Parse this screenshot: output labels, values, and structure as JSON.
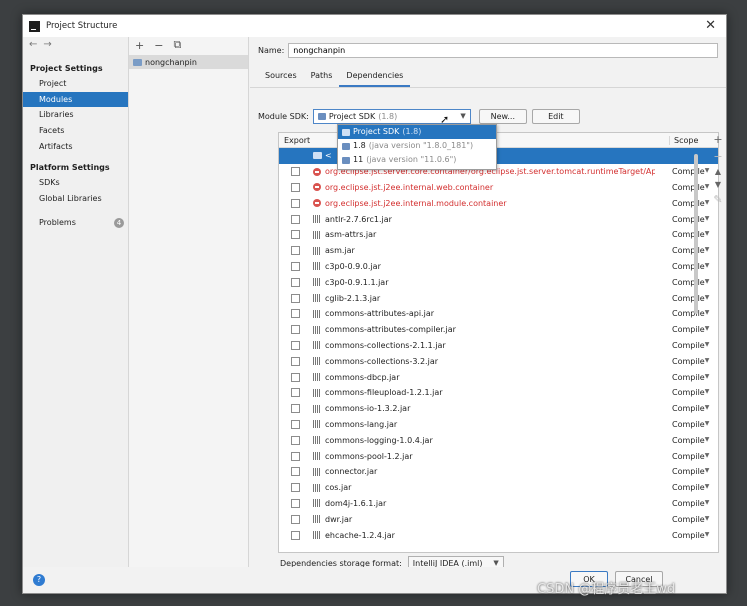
{
  "window": {
    "title": "Project Structure"
  },
  "nav": {
    "sections": [
      {
        "header": "Project Settings",
        "items": [
          "Project",
          "Modules",
          "Libraries",
          "Facets",
          "Artifacts"
        ]
      },
      {
        "header": "Platform Settings",
        "items": [
          "SDKs",
          "Global Libraries"
        ]
      }
    ],
    "selected": "Modules",
    "problems_label": "Problems",
    "problems_count": "4"
  },
  "modules": {
    "toolbar": [
      "+",
      "−",
      "⧉"
    ],
    "items": [
      "nongchanpin"
    ]
  },
  "module": {
    "name_label": "Name:",
    "name_value": "nongchanpin",
    "tabs": [
      "Sources",
      "Paths",
      "Dependencies"
    ],
    "active_tab": "Dependencies",
    "sdk_label": "Module SDK:",
    "sdk_value": "Project SDK",
    "sdk_value_hint": "(1.8)",
    "new_button": "New...",
    "edit_button": "Edit",
    "sdk_options": [
      {
        "name": "Project SDK",
        "hint": "(1.8)"
      },
      {
        "name": "1.8",
        "hint": "(java version \"1.8.0_181\")"
      },
      {
        "name": "11",
        "hint": "(java version \"11.0.6\")"
      }
    ]
  },
  "dependencies": {
    "col_export": "Export",
    "col_scope": "Scope",
    "first_row": "<",
    "rows": [
      {
        "name": "org.eclipse.jst.server.core.container/org.eclipse.jst.server.tomcat.runtimeTarget/Apache Tomcat v8.5",
        "scope": "Compile",
        "error": true
      },
      {
        "name": "org.eclipse.jst.j2ee.internal.web.container",
        "scope": "Compile",
        "error": true
      },
      {
        "name": "org.eclipse.jst.j2ee.internal.module.container",
        "scope": "Compile",
        "error": true
      },
      {
        "name": "antlr-2.7.6rc1.jar",
        "scope": "Compile",
        "error": false
      },
      {
        "name": "asm-attrs.jar",
        "scope": "Compile",
        "error": false
      },
      {
        "name": "asm.jar",
        "scope": "Compile",
        "error": false
      },
      {
        "name": "c3p0-0.9.0.jar",
        "scope": "Compile",
        "error": false
      },
      {
        "name": "c3p0-0.9.1.1.jar",
        "scope": "Compile",
        "error": false
      },
      {
        "name": "cglib-2.1.3.jar",
        "scope": "Compile",
        "error": false
      },
      {
        "name": "commons-attributes-api.jar",
        "scope": "Compile",
        "error": false
      },
      {
        "name": "commons-attributes-compiler.jar",
        "scope": "Compile",
        "error": false
      },
      {
        "name": "commons-collections-2.1.1.jar",
        "scope": "Compile",
        "error": false
      },
      {
        "name": "commons-collections-3.2.jar",
        "scope": "Compile",
        "error": false
      },
      {
        "name": "commons-dbcp.jar",
        "scope": "Compile",
        "error": false
      },
      {
        "name": "commons-fileupload-1.2.1.jar",
        "scope": "Compile",
        "error": false
      },
      {
        "name": "commons-io-1.3.2.jar",
        "scope": "Compile",
        "error": false
      },
      {
        "name": "commons-lang.jar",
        "scope": "Compile",
        "error": false
      },
      {
        "name": "commons-logging-1.0.4.jar",
        "scope": "Compile",
        "error": false
      },
      {
        "name": "commons-pool-1.2.jar",
        "scope": "Compile",
        "error": false
      },
      {
        "name": "connector.jar",
        "scope": "Compile",
        "error": false
      },
      {
        "name": "cos.jar",
        "scope": "Compile",
        "error": false
      },
      {
        "name": "dom4j-1.6.1.jar",
        "scope": "Compile",
        "error": false
      },
      {
        "name": "dwr.jar",
        "scope": "Compile",
        "error": false
      },
      {
        "name": "ehcache-1.2.4.jar",
        "scope": "Compile",
        "error": false
      }
    ],
    "side_tools": [
      "+",
      "−",
      "▲",
      "▼",
      "✎"
    ]
  },
  "storage": {
    "label": "Dependencies storage format:",
    "value": "IntelliJ IDEA (.iml)"
  },
  "footer": {
    "ok": "OK",
    "cancel": "Cancel",
    "help": "?"
  },
  "watermark": "CSDN @程序员老王wd"
}
